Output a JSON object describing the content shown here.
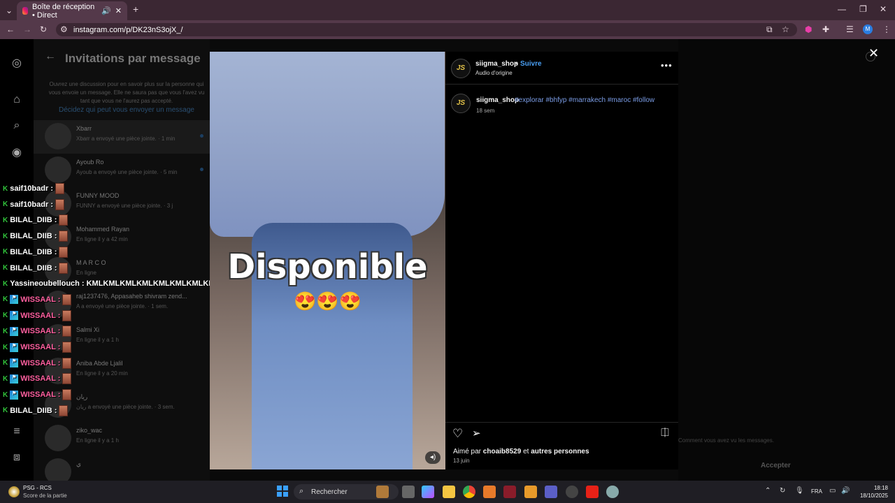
{
  "browser": {
    "tab_title": "Boîte de réception • Direct",
    "url": "instagram.com/p/DK23nS3ojX_/",
    "profile_initial": "M"
  },
  "inbox": {
    "title": "Invitations par message",
    "description": "Ouvrez une discussion pour en savoir plus sur la personne qui vous envoie un message. Elle ne saura pas que vous l'avez vu tant que vous ne l'aurez pas accepté.",
    "link": "Décidez qui peut vous envoyer un message",
    "rows": [
      {
        "name": "Xbarr",
        "sub": "Xbarr a envoyé une pièce jointe. · 1 min",
        "unread": true
      },
      {
        "name": "Ayoub Ro",
        "sub": "Ayoub a envoyé une pièce jointe. · 5 min",
        "unread": true
      },
      {
        "name": "FUNNY MOOD",
        "sub": "FUNNY a envoyé une pièce jointe. · 3 j",
        "unread": false
      },
      {
        "name": "Mohammed Rayan",
        "sub": "En ligne il y a 42 min",
        "unread": false
      },
      {
        "name": "M A R C O",
        "sub": "En ligne",
        "unread": false
      },
      {
        "name": "raj1237476, Appasaheb shivram zend...",
        "sub": "A a envoyé une pièce jointe. · 1 sem.",
        "unread": false
      },
      {
        "name": "Salmi Xi",
        "sub": "En ligne il y a 1 h",
        "unread": false
      },
      {
        "name": "Aniba Abde Ljalil",
        "sub": "En ligne il y a 20 min",
        "unread": false
      },
      {
        "name": "ريان",
        "sub": "ريان a envoyé une pièce jointe. · 3 sem.",
        "unread": false
      },
      {
        "name": "ziko_wac",
        "sub": "En ligne il y a 1 h",
        "unread": false
      },
      {
        "name": "ي",
        "sub": "",
        "unread": false
      }
    ],
    "footer_text": "Comment vous avez vu les messages.",
    "accept_label": "Accepter"
  },
  "chat_overlay": [
    {
      "user": "saif10badr :",
      "badge": false,
      "pink": false,
      "msg": ""
    },
    {
      "user": "saif10badr :",
      "badge": false,
      "pink": false,
      "msg": ""
    },
    {
      "user": "BILAL_DIIB :",
      "badge": false,
      "pink": false,
      "msg": ""
    },
    {
      "user": "BILAL_DIIB :",
      "badge": false,
      "pink": false,
      "msg": ""
    },
    {
      "user": "BILAL_DIIB :",
      "badge": false,
      "pink": false,
      "msg": ""
    },
    {
      "user": "BILAL_DIIB :",
      "badge": false,
      "pink": false,
      "msg": ""
    },
    {
      "user": "Yassineoubellouch :",
      "badge": false,
      "pink": false,
      "msg": "KMLKMLKMLKMLKMLKMLKMLKMLKMLKMLKMLK"
    },
    {
      "user": "WISSAAL :",
      "badge": true,
      "pink": true,
      "msg": ""
    },
    {
      "user": "WISSAAL :",
      "badge": true,
      "pink": true,
      "msg": ""
    },
    {
      "user": "WISSAAL :",
      "badge": true,
      "pink": true,
      "msg": ""
    },
    {
      "user": "WISSAAL :",
      "badge": true,
      "pink": true,
      "msg": ""
    },
    {
      "user": "WISSAAL :",
      "badge": true,
      "pink": true,
      "msg": ""
    },
    {
      "user": "WISSAAL :",
      "badge": true,
      "pink": true,
      "msg": ""
    },
    {
      "user": "WISSAAL :",
      "badge": true,
      "pink": true,
      "msg": ""
    },
    {
      "user": "BILAL_DIIB :",
      "badge": false,
      "pink": false,
      "msg": ""
    }
  ],
  "post": {
    "video_caption": "Disponible",
    "video_emojis": "😍😍😍",
    "account": "siigma_shop",
    "separator": "•",
    "follow": "Suivre",
    "audio": "Audio d'origine",
    "avatar_text": "JS",
    "caption_user": "siigma_shop",
    "caption_tags": "#explorar #bhfyp #marrakech #maroc #follow",
    "caption_time": "18 sem",
    "liked_prefix": "Aimé par",
    "liked_user": "choaib8529",
    "liked_mid": "et",
    "liked_others": "autres personnes",
    "date": "13 juin"
  },
  "taskbar": {
    "news_title": "PSG - RCS",
    "news_sub": "Score de la partie",
    "search_label": "Rechercher",
    "lang": "FRA",
    "time": "18:18",
    "date": "18/10/2025"
  },
  "colors": {
    "accent_link": "#4aa0f5",
    "hashtag": "#7b9de6",
    "tab_bar": "#3b2733"
  }
}
